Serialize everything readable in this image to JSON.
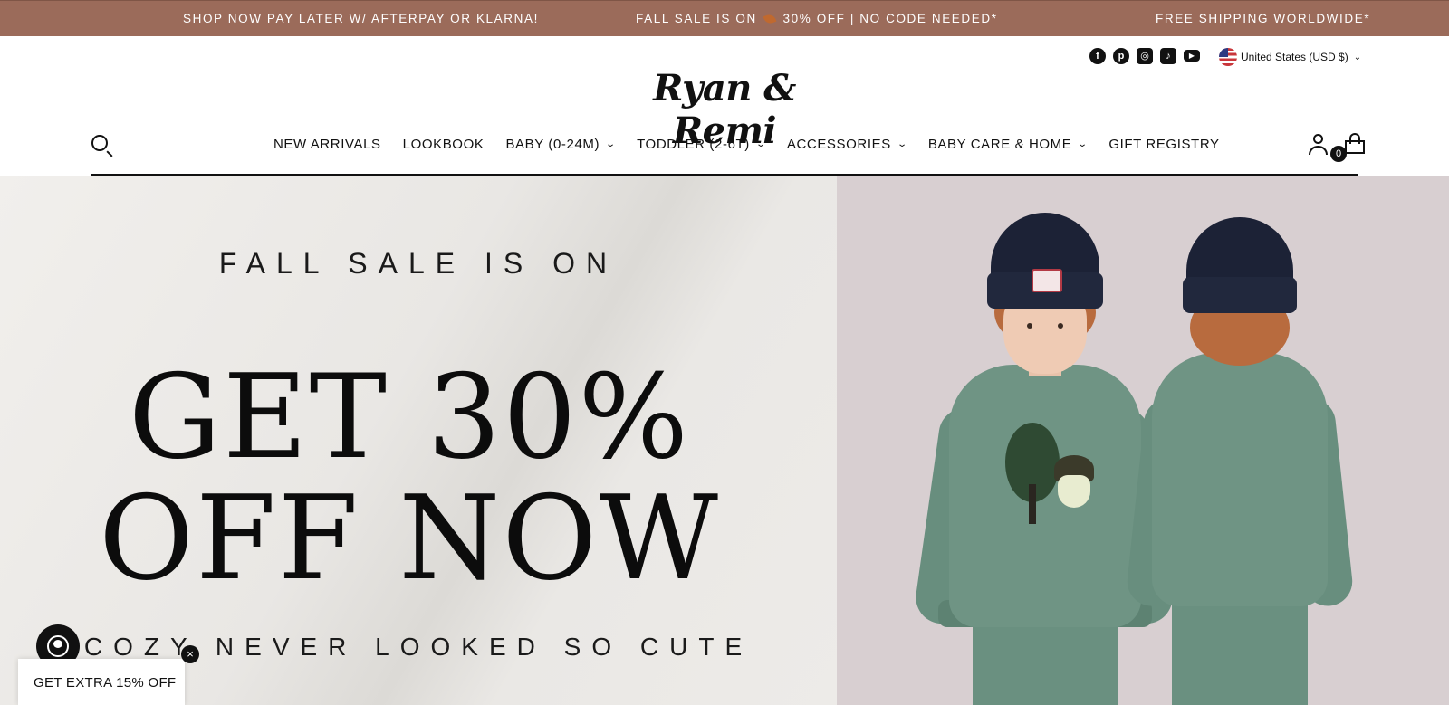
{
  "announcement": {
    "item1": "SHOP NOW PAY LATER W/ AFTERPAY OR KLARNA!",
    "item2_before": "FALL SALE IS ON",
    "item2_after": "30% OFF | NO CODE NEEDED*",
    "item3": "FREE SHIPPING WORLDWIDE*",
    "background": "#9b6b5a"
  },
  "header": {
    "social_icons": [
      "facebook-icon",
      "pinterest-icon",
      "instagram-icon",
      "tiktok-icon",
      "youtube-icon"
    ],
    "currency": "United States (USD $)",
    "logo": "Ryan & Remi",
    "cart_count": "0"
  },
  "nav": {
    "items": [
      {
        "label": "NEW ARRIVALS",
        "dropdown": false
      },
      {
        "label": "LOOKBOOK",
        "dropdown": false
      },
      {
        "label": "BABY (0-24M)",
        "dropdown": true
      },
      {
        "label": "TODDLER (2-6T)",
        "dropdown": true
      },
      {
        "label": "ACCESSORIES",
        "dropdown": true
      },
      {
        "label": "BABY CARE & HOME",
        "dropdown": true
      },
      {
        "label": "GIFT REGISTRY",
        "dropdown": false
      }
    ]
  },
  "hero": {
    "kicker": "FALL SALE IS ON",
    "headline1": "GET 30%",
    "headline2": "OFF NOW",
    "tagline": "COZY NEVER LOOKED SO CUTE"
  },
  "widgets": {
    "promo_label": "GET EXTRA 15% OFF",
    "close_glyph": "×"
  }
}
